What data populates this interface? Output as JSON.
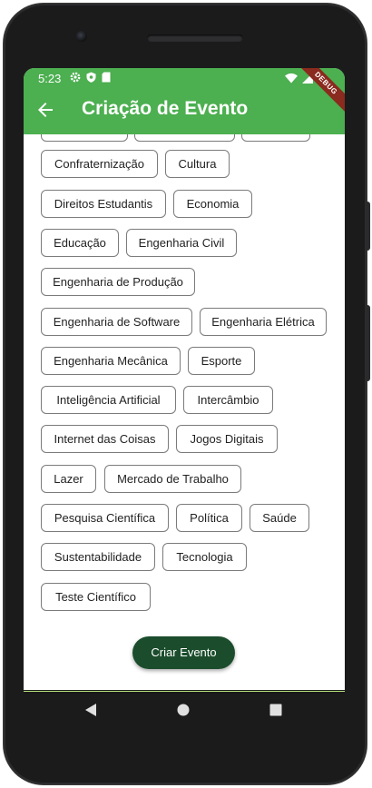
{
  "status_bar": {
    "time": "5:23"
  },
  "debug_ribbon": "DEBUG",
  "app_bar": {
    "title": "Criação de Evento"
  },
  "chips": [
    {
      "label": "Confraternização"
    },
    {
      "label": "Cultura"
    },
    {
      "label": "Direitos Estudantis"
    },
    {
      "label": "Economia"
    },
    {
      "label": "Educação"
    },
    {
      "label": "Engenharia Civil"
    },
    {
      "label": "Engenharia de Produção"
    },
    {
      "label": "Engenharia de Software"
    },
    {
      "label": "Engenharia Elétrica"
    },
    {
      "label": "Engenharia Mecânica"
    },
    {
      "label": "Esporte"
    },
    {
      "label": "Inteligência Artificial"
    },
    {
      "label": "Intercâmbio"
    },
    {
      "label": "Internet das Coisas"
    },
    {
      "label": "Jogos Digitais"
    },
    {
      "label": "Lazer"
    },
    {
      "label": "Mercado de Trabalho"
    },
    {
      "label": "Pesquisa Científica"
    },
    {
      "label": "Política"
    },
    {
      "label": "Saúde"
    },
    {
      "label": "Sustentabilidade"
    },
    {
      "label": "Tecnologia"
    },
    {
      "label": "Teste Científico"
    }
  ],
  "create_button": {
    "label": "Criar Evento"
  },
  "colors": {
    "app_bar": "#4caf50",
    "primary_button": "#1b4d2c",
    "chip_border": "#7b7b7b"
  }
}
